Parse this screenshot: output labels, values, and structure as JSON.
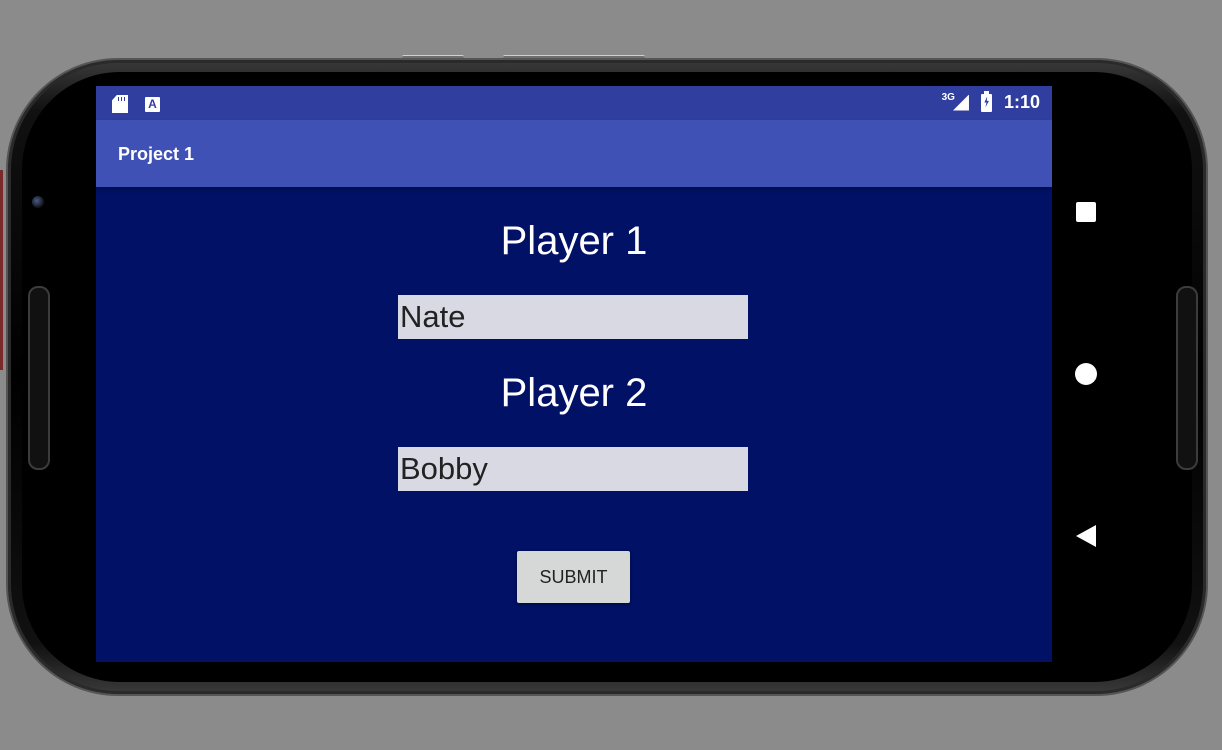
{
  "status_bar": {
    "icons_left": [
      "sd-card-icon",
      "app-notification-icon"
    ],
    "network_type": "3G",
    "time": "1:10"
  },
  "app_bar": {
    "title": "Project 1"
  },
  "form": {
    "player1_label": "Player 1",
    "player1_value": "Nate",
    "player2_label": "Player 2",
    "player2_value": "Bobby",
    "submit_label": "SUBMIT"
  },
  "nav_bar": {
    "buttons": [
      "recent-apps-icon",
      "home-icon",
      "back-icon"
    ]
  },
  "colors": {
    "status_bar": "#303f9f",
    "app_bar": "#3f51b5",
    "background": "#001166",
    "input_fill": "#d8d9e3",
    "button_fill": "#d6d7d7"
  }
}
